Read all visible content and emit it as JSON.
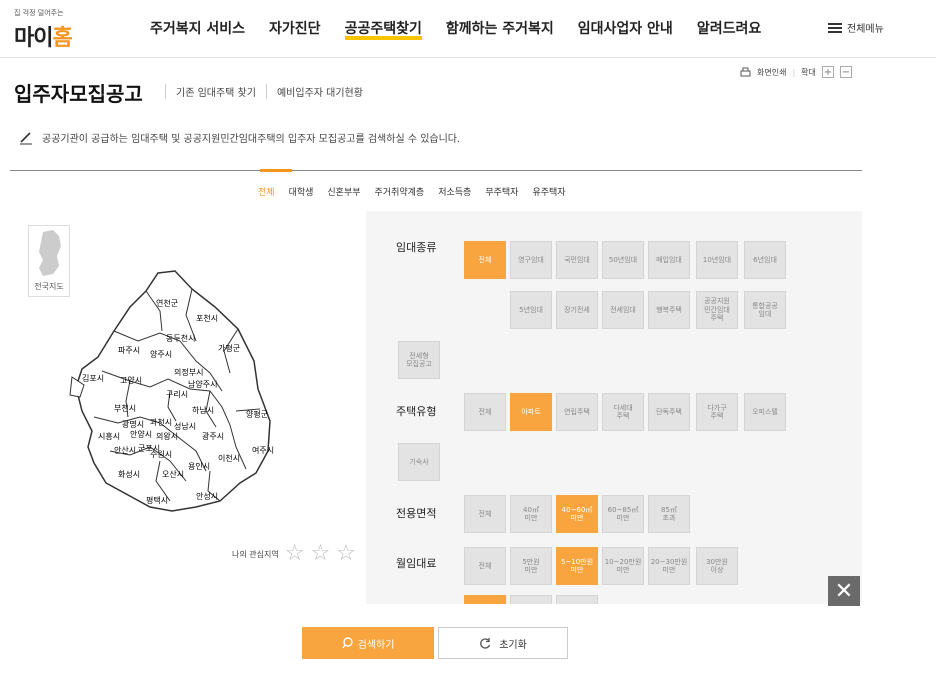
{
  "logo": {
    "tagline": "집 걱정 덜어주는",
    "name_part1": "마이",
    "name_part2": "홈"
  },
  "gnb": {
    "items": [
      {
        "label": "주거복지 서비스",
        "active": false
      },
      {
        "label": "자가진단",
        "active": false
      },
      {
        "label": "공공주택찾기",
        "active": true
      },
      {
        "label": "함께하는 주거복지",
        "active": false
      },
      {
        "label": "임대사업자 안내",
        "active": false
      },
      {
        "label": "알려드려요",
        "active": false
      }
    ],
    "all_menu": "전체메뉴"
  },
  "utils": {
    "print": "화면인쇄",
    "zoom": "확대",
    "plus": "+",
    "minus": "−"
  },
  "page": {
    "title": "입주자모집공고",
    "subnav": [
      "기존 임대주택 찾기",
      "예비입주자 대기현황"
    ],
    "description": "공공기관이 공급하는 임대주택 및 공공지원민간임대주택의 입주자 모집공고를 검색하실 수 있습니다."
  },
  "tabs": [
    {
      "label": "전체",
      "active": true
    },
    {
      "label": "대학생",
      "active": false
    },
    {
      "label": "신혼부부",
      "active": false
    },
    {
      "label": "주거취약계층",
      "active": false
    },
    {
      "label": "저소득층",
      "active": false
    },
    {
      "label": "무주택자",
      "active": false
    },
    {
      "label": "유주택자",
      "active": false
    }
  ],
  "map": {
    "nationwide_label": "전국지도",
    "regions": [
      "연천군",
      "포천시",
      "동두천시",
      "가평군",
      "파주시",
      "양주시",
      "의정부시",
      "김포시",
      "고양시",
      "남양주시",
      "구리시",
      "부천시",
      "하남시",
      "양평군",
      "광명시",
      "과천시",
      "성남시",
      "시흥시",
      "안양시",
      "의왕시",
      "광주시",
      "안산시",
      "군포시",
      "수원시",
      "여주시",
      "이천시",
      "화성시",
      "오산시",
      "용인시",
      "평택시",
      "안성시"
    ],
    "favorite_label": "나의 관심지역"
  },
  "filters": {
    "rental_type": {
      "label": "임대종류",
      "options": [
        {
          "label": "전체",
          "on": true
        },
        {
          "label": "영구임대",
          "on": false
        },
        {
          "label": "국민임대",
          "on": false
        },
        {
          "label": "50년임대",
          "on": false
        },
        {
          "label": "매입임대",
          "on": false
        },
        {
          "label": "10년임대",
          "on": false
        },
        {
          "label": "6년임대",
          "on": false
        },
        {
          "label": "5년임대",
          "on": false
        },
        {
          "label": "장기전세",
          "on": false
        },
        {
          "label": "전세임대",
          "on": false
        },
        {
          "label": "행복주택",
          "on": false
        },
        {
          "label": "공공지원\n민간임대\n주택",
          "on": false
        },
        {
          "label": "통합공공\n임대",
          "on": false
        },
        {
          "label": "전세형\n모집공고",
          "on": false
        }
      ]
    },
    "house_type": {
      "label": "주택유형",
      "options": [
        {
          "label": "전체",
          "on": false
        },
        {
          "label": "아파트",
          "on": true
        },
        {
          "label": "연립주택",
          "on": false
        },
        {
          "label": "다세대\n주택",
          "on": false
        },
        {
          "label": "단독주택",
          "on": false
        },
        {
          "label": "다가구\n주택",
          "on": false
        },
        {
          "label": "오피스텔",
          "on": false
        },
        {
          "label": "기숙사",
          "on": false
        }
      ]
    },
    "area": {
      "label": "전용면적",
      "options": [
        {
          "label": "전체",
          "on": false
        },
        {
          "label": "40㎡\n미만",
          "on": false
        },
        {
          "label": "40~60㎡\n미만",
          "on": true
        },
        {
          "label": "60~85㎡\n미만",
          "on": false
        },
        {
          "label": "85㎡\n초과",
          "on": false
        }
      ]
    },
    "rent": {
      "label": "월임대료",
      "options": [
        {
          "label": "전체",
          "on": false
        },
        {
          "label": "5만원\n미만",
          "on": false
        },
        {
          "label": "5~10만원\n미만",
          "on": true
        },
        {
          "label": "10~20만원\n미만",
          "on": false
        },
        {
          "label": "20~30만원\n미만",
          "on": false
        },
        {
          "label": "30만원\n이상",
          "on": false
        }
      ]
    }
  },
  "actions": {
    "search": "검색하기",
    "reset": "초기화",
    "close": "✕"
  },
  "colors": {
    "accent": "#f9a53f",
    "highlight_underline": "#f9c400"
  }
}
